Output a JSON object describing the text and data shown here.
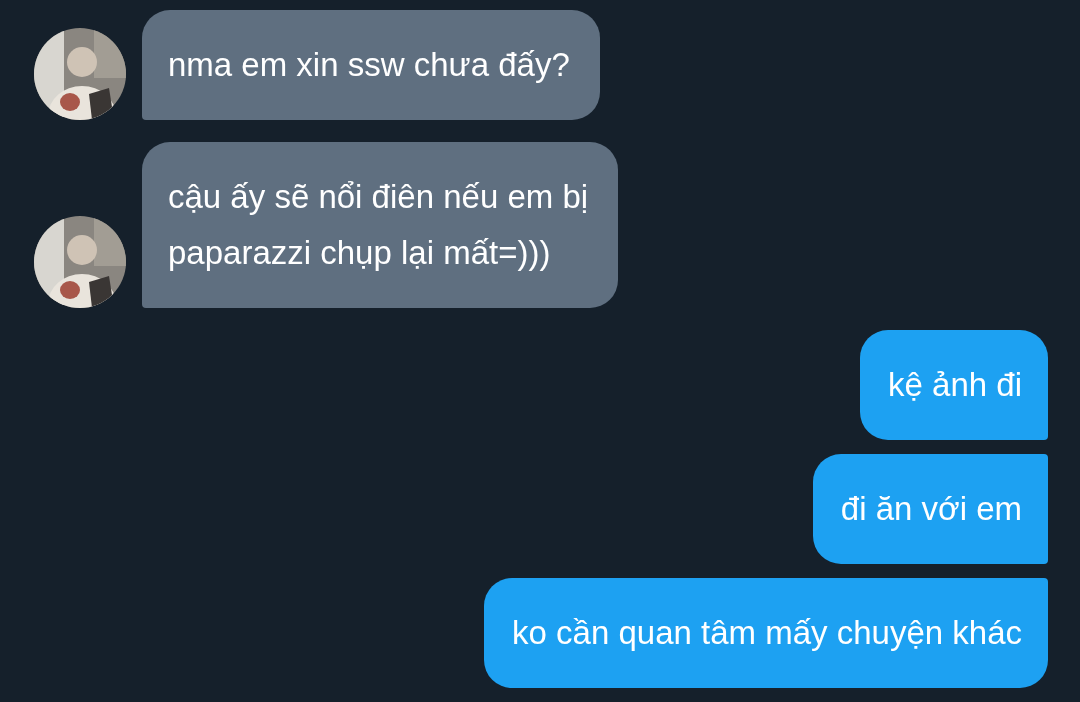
{
  "messages": [
    {
      "kind": "incoming",
      "avatar": {
        "kind": "picture"
      },
      "lines": [
        "nma em xin ssw chưa đấy?"
      ]
    },
    {
      "kind": "incoming",
      "avatar": {
        "kind": "picture"
      },
      "lines": [
        "cậu ấy sẽ nổi điên nếu em bị",
        "paparazzi chụp lại mất=)))"
      ]
    },
    {
      "kind": "outgoing",
      "lines": [
        "kệ ảnh đi"
      ]
    },
    {
      "kind": "outgoing",
      "lines": [
        "đi ăn với em"
      ]
    },
    {
      "kind": "outgoing",
      "lines": [
        "ko cần quan tâm mấy chuyện khác"
      ]
    }
  ]
}
